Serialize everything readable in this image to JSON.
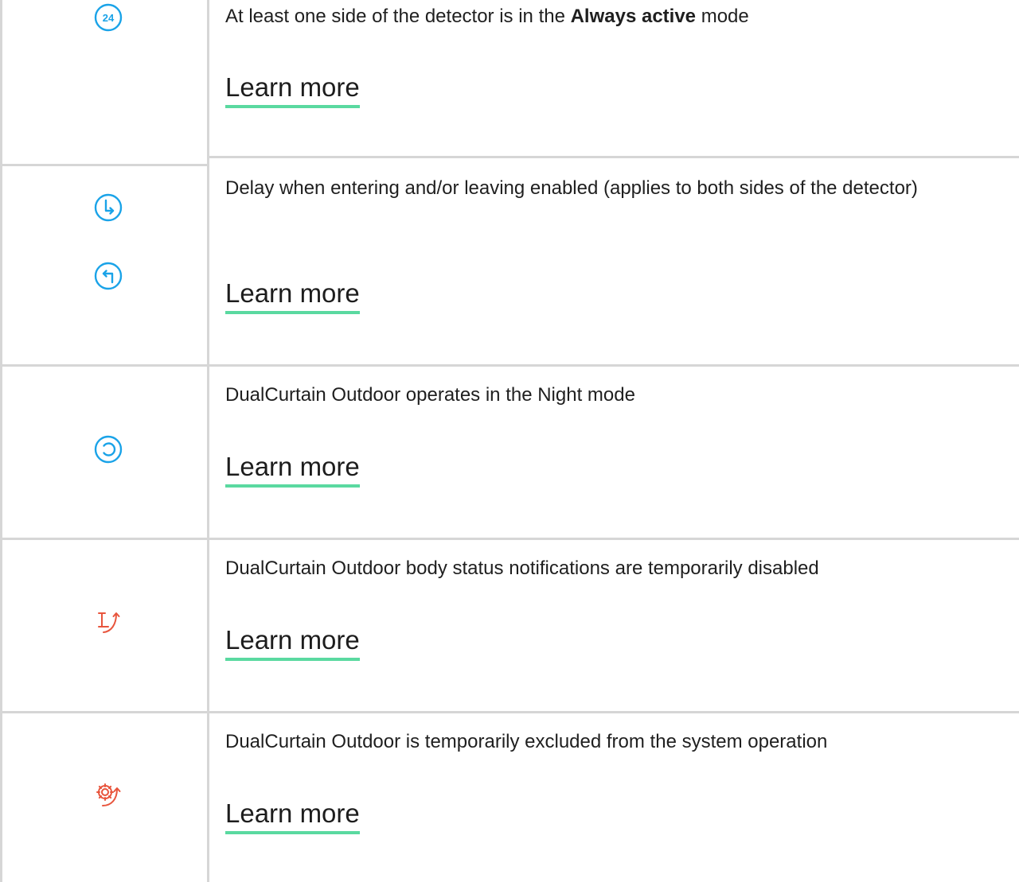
{
  "rows": [
    {
      "desc_pre": "At least one side of the detector is in the ",
      "desc_bold": "Always active",
      "desc_post": " mode",
      "link": "Learn more",
      "icons": [
        "always-active-24-icon"
      ],
      "icon_color": "#1aa3e8"
    },
    {
      "desc": "Delay when entering and/or leaving enabled (applies to both sides of the detector)",
      "link": "Learn more",
      "icons": [
        "delay-entering-icon",
        "delay-leaving-icon"
      ],
      "icon_color": "#1aa3e8"
    },
    {
      "desc": "DualCurtain Outdoor operates in the Night mode",
      "link": "Learn more",
      "icons": [
        "night-mode-icon"
      ],
      "icon_color": "#1aa3e8"
    },
    {
      "desc": "DualCurtain Outdoor body status notifications are temporarily disabled",
      "link": "Learn more",
      "icons": [
        "lid-notifications-disabled-icon"
      ],
      "icon_color": "#e8553d"
    },
    {
      "desc": "DualCurtain Outdoor is temporarily excluded from the system operation",
      "link": "Learn more",
      "icons": [
        "temporarily-deactivated-icon"
      ],
      "icon_color": "#e8553d"
    }
  ]
}
